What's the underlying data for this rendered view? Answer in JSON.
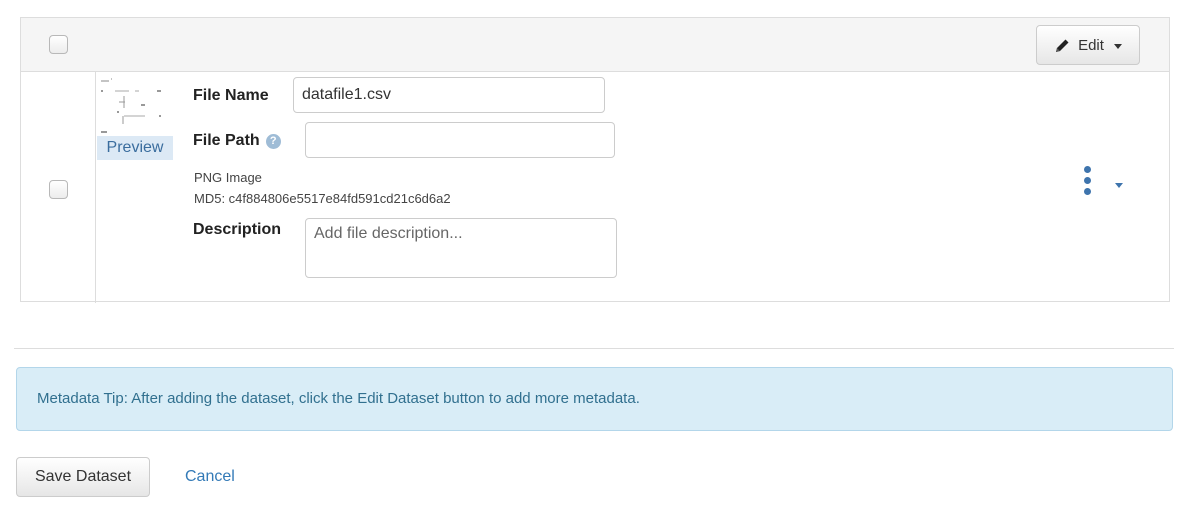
{
  "header": {
    "edit_label": "Edit",
    "icons": {
      "edit": "pencil-icon",
      "dropdown": "caret-down-icon"
    }
  },
  "file": {
    "preview_label": "Preview",
    "file_name_label": "File Name",
    "file_name_value": "datafile1.csv",
    "file_path_label": "File Path",
    "file_path_value": "",
    "file_path_help_icon": "question-circle-icon",
    "file_type": "PNG Image",
    "md5": "MD5: c4f884806e5517e84fd591cd21c6d6a2",
    "description_label": "Description",
    "description_placeholder": "Add file description...",
    "actions_icon": "kebab-menu-icon"
  },
  "tip": {
    "text": "Metadata Tip: After adding the dataset, click the Edit Dataset button to add more metadata."
  },
  "actions": {
    "save_label": "Save Dataset",
    "cancel_label": "Cancel"
  },
  "colors": {
    "link": "#337ab7",
    "tip_background": "#d9edf7",
    "tip_text": "#31708f",
    "accent": "#3e74ad"
  }
}
